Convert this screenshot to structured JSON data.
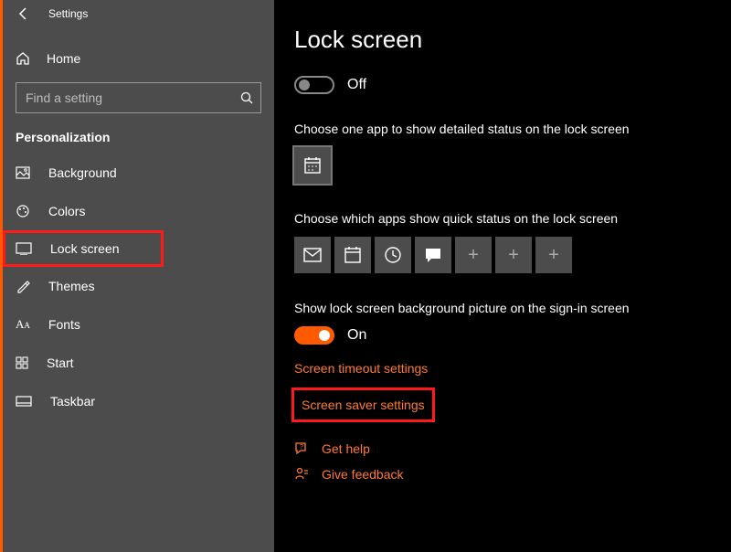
{
  "window_title": "Settings",
  "home_label": "Home",
  "search_placeholder": "Find a setting",
  "category": "Personalization",
  "sidebar": {
    "items": [
      {
        "label": "Background"
      },
      {
        "label": "Colors"
      },
      {
        "label": "Lock screen"
      },
      {
        "label": "Themes"
      },
      {
        "label": "Fonts"
      },
      {
        "label": "Start"
      },
      {
        "label": "Taskbar"
      }
    ]
  },
  "page": {
    "title": "Lock screen",
    "toggle1_state": "Off",
    "detailed_label": "Choose one app to show detailed status on the lock screen",
    "quick_label": "Choose which apps show quick status on the lock screen",
    "bgpic_label": "Show lock screen background picture on the sign-in screen",
    "toggle2_state": "On",
    "link_timeout": "Screen timeout settings",
    "link_saver": "Screen saver settings",
    "help": "Get help",
    "feedback": "Give feedback"
  }
}
